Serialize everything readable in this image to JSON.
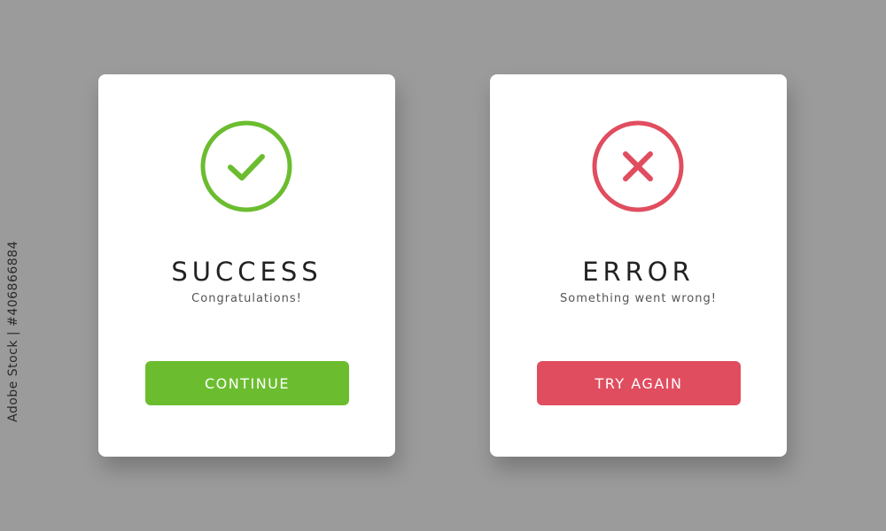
{
  "colors": {
    "background": "#9c9b9c",
    "card": "#ffffff",
    "success": "#6bbd2f",
    "error": "#e04d5f",
    "title": "#222222",
    "subtitle": "#555555"
  },
  "success_card": {
    "icon": "check-circle-icon",
    "title": "SUCCESS",
    "subtitle": "Congratulations!",
    "button_label": "CONTINUE"
  },
  "error_card": {
    "icon": "x-circle-icon",
    "title": "ERROR",
    "subtitle": "Something went wrong!",
    "button_label": "TRY AGAIN"
  },
  "watermark": {
    "stock_id": "Adobe Stock | #406866884"
  }
}
